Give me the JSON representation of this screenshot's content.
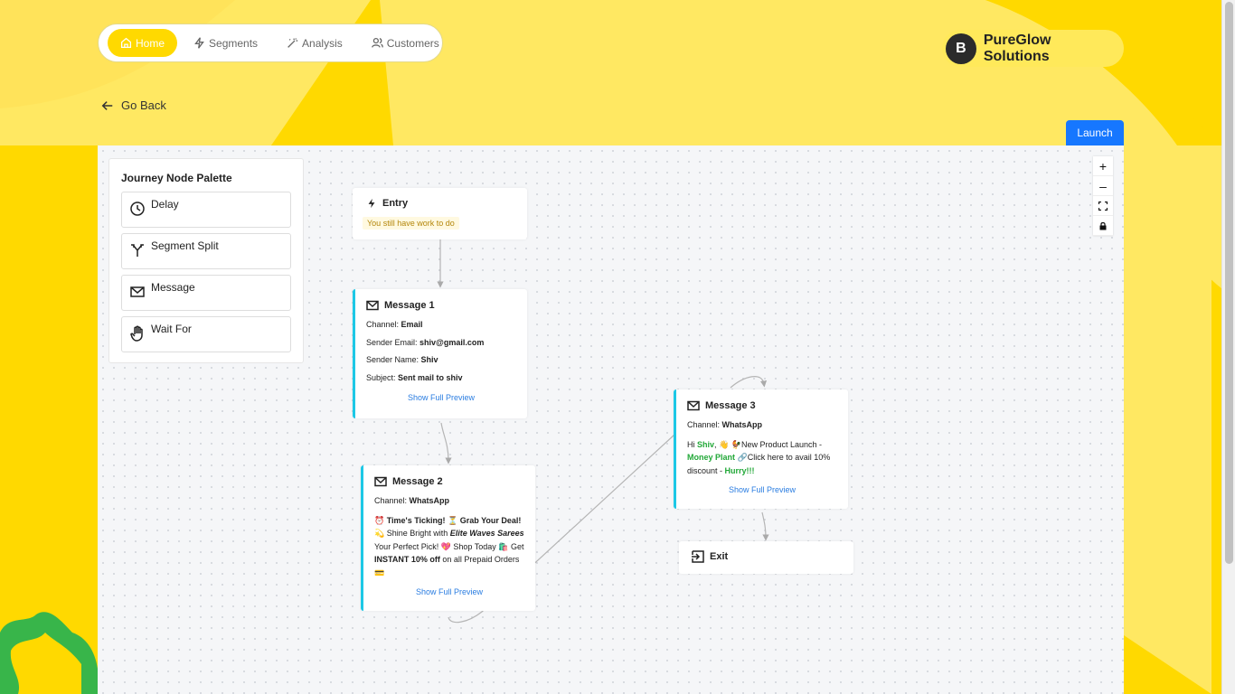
{
  "nav": {
    "items": [
      {
        "label": "Home",
        "icon": "home-icon"
      },
      {
        "label": "Segments",
        "icon": "bolt-icon"
      },
      {
        "label": "Analysis",
        "icon": "wand-icon"
      },
      {
        "label": "Customers",
        "icon": "users-icon"
      }
    ],
    "active": "Home"
  },
  "brand": {
    "avatar_letter": "B",
    "name": "PureGlow Solutions"
  },
  "go_back": "Go Back",
  "launch": "Launch",
  "palette": {
    "title": "Journey Node Palette",
    "items": [
      {
        "label": "Delay",
        "icon": "clock-icon"
      },
      {
        "label": "Segment Split",
        "icon": "split-icon"
      },
      {
        "label": "Message",
        "icon": "mail-icon"
      },
      {
        "label": "Wait For",
        "icon": "hand-icon"
      }
    ]
  },
  "zoom": {
    "plus": "+",
    "minus": "–"
  },
  "nodes": {
    "entry": {
      "title": "Entry",
      "warning": "You still have work to do"
    },
    "message1": {
      "title": "Message 1",
      "channel_label": "Channel:",
      "channel": "Email",
      "sender_email_label": "Sender Email:",
      "sender_email": "shiv@gmail.com",
      "sender_name_label": "Sender Name:",
      "sender_name": "Shiv",
      "subject_label": "Subject:",
      "subject": "Sent mail to shiv",
      "preview": "Show Full Preview"
    },
    "message2": {
      "title": "Message 2",
      "channel_label": "Channel:",
      "channel": "WhatsApp",
      "text": {
        "p1": "⏰ Time's Ticking! ⏳ Grab Your Deal!",
        "p2": "💫 Shine Bright with",
        "p3": "Elite Waves Sarees",
        "p4": "Your Perfect Pick! 💖 Shop Today 🛍️ Get",
        "p5": "INSTANT 10% off",
        "p6": "on all Prepaid Orders 💳"
      },
      "preview": "Show Full Preview"
    },
    "message3": {
      "title": "Message 3",
      "channel_label": "Channel:",
      "channel": "WhatsApp",
      "text": {
        "p1": "Hi",
        "p2": "Shiv",
        "p3": ", 👋 🐓New Product Launch -",
        "p4": "Money Plant",
        "p5": "🔗Click here to avail 10% discount -",
        "p6": "Hurry!!!"
      },
      "preview": "Show Full Preview"
    },
    "exit": {
      "title": "Exit"
    }
  },
  "colors": {
    "brand_yellow": "#FFD900",
    "accent_blue": "#1677ff",
    "node_accent": "#1dc8e6",
    "highlight_green": "#22a838"
  }
}
